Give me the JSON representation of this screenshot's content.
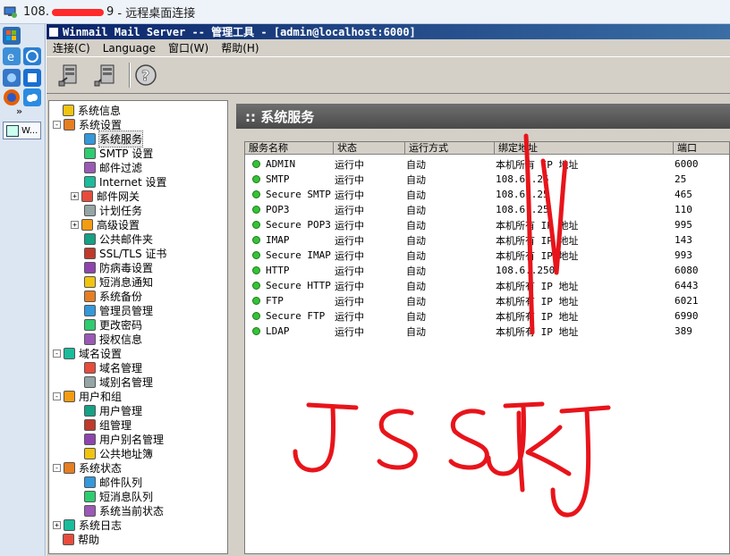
{
  "rdp": {
    "title_ip_prefix": "108.",
    "title_ip_suffix": "9",
    "title_text": "- 远程桌面连接"
  },
  "taskbar": {
    "more": "»",
    "task_label": "W..."
  },
  "app": {
    "title": "Winmail Mail Server -- 管理工具 - [admin@localhost:6000]",
    "menu": [
      "连接(C)",
      "Language",
      "窗口(W)",
      "帮助(H)"
    ]
  },
  "tree": [
    {
      "label": "系统信息",
      "icon": "info-icon",
      "level": 0,
      "exp": ""
    },
    {
      "label": "系统设置",
      "icon": "settings-folder-icon",
      "level": 0,
      "exp": "-"
    },
    {
      "label": "系统服务",
      "icon": "service-icon",
      "level": 1,
      "exp": "",
      "selected": true
    },
    {
      "label": "SMTP 设置",
      "icon": "smtp-icon",
      "level": 1,
      "exp": ""
    },
    {
      "label": "邮件过滤",
      "icon": "filter-icon",
      "level": 1,
      "exp": ""
    },
    {
      "label": "Internet 设置",
      "icon": "internet-icon",
      "level": 1,
      "exp": ""
    },
    {
      "label": "邮件网关",
      "icon": "gateway-icon",
      "level": 1,
      "exp": "+"
    },
    {
      "label": "计划任务",
      "icon": "schedule-icon",
      "level": 1,
      "exp": ""
    },
    {
      "label": "高级设置",
      "icon": "advanced-icon",
      "level": 1,
      "exp": "+"
    },
    {
      "label": "公共邮件夹",
      "icon": "public-folder-icon",
      "level": 1,
      "exp": ""
    },
    {
      "label": "SSL/TLS 证书",
      "icon": "certificate-icon",
      "level": 1,
      "exp": ""
    },
    {
      "label": "防病毒设置",
      "icon": "antivirus-icon",
      "level": 1,
      "exp": ""
    },
    {
      "label": "短消息通知",
      "icon": "sms-icon",
      "level": 1,
      "exp": ""
    },
    {
      "label": "系统备份",
      "icon": "backup-icon",
      "level": 1,
      "exp": ""
    },
    {
      "label": "管理员管理",
      "icon": "admin-icon",
      "level": 1,
      "exp": ""
    },
    {
      "label": "更改密码",
      "icon": "password-icon",
      "level": 1,
      "exp": ""
    },
    {
      "label": "授权信息",
      "icon": "license-icon",
      "level": 1,
      "exp": ""
    },
    {
      "label": "域名设置",
      "icon": "domain-settings-icon",
      "level": 0,
      "exp": "-"
    },
    {
      "label": "域名管理",
      "icon": "domain-icon",
      "level": 1,
      "exp": ""
    },
    {
      "label": "域别名管理",
      "icon": "domain-alias-icon",
      "level": 1,
      "exp": ""
    },
    {
      "label": "用户和组",
      "icon": "users-groups-icon",
      "level": 0,
      "exp": "-"
    },
    {
      "label": "用户管理",
      "icon": "user-icon",
      "level": 1,
      "exp": ""
    },
    {
      "label": "组管理",
      "icon": "group-icon",
      "level": 1,
      "exp": ""
    },
    {
      "label": "用户别名管理",
      "icon": "user-alias-icon",
      "level": 1,
      "exp": ""
    },
    {
      "label": "公共地址簿",
      "icon": "address-book-icon",
      "level": 1,
      "exp": ""
    },
    {
      "label": "系统状态",
      "icon": "status-icon",
      "level": 0,
      "exp": "-"
    },
    {
      "label": "邮件队列",
      "icon": "mail-queue-icon",
      "level": 1,
      "exp": ""
    },
    {
      "label": "短消息队列",
      "icon": "sms-queue-icon",
      "level": 1,
      "exp": ""
    },
    {
      "label": "系统当前状态",
      "icon": "current-status-icon",
      "level": 1,
      "exp": ""
    },
    {
      "label": "系统日志",
      "icon": "log-icon",
      "level": 0,
      "exp": "+"
    },
    {
      "label": "帮助",
      "icon": "help-icon",
      "level": 0,
      "exp": ""
    }
  ],
  "content": {
    "header": ":: 系统服务",
    "columns": [
      "服务名称",
      "状态",
      "运行方式",
      "绑定地址",
      "端口"
    ],
    "rows": [
      {
        "name": "ADMIN",
        "status": "运行中",
        "mode": "自动",
        "addr": "本机所有 IP 地址",
        "port": "6000"
      },
      {
        "name": "SMTP",
        "status": "运行中",
        "mode": "自动",
        "addr": "108.6..25",
        "port": "25"
      },
      {
        "name": "Secure SMTP",
        "status": "运行中",
        "mode": "自动",
        "addr": "108.6..25",
        "port": "465"
      },
      {
        "name": "POP3",
        "status": "运行中",
        "mode": "自动",
        "addr": "108.6..25",
        "port": "110"
      },
      {
        "name": "Secure POP3",
        "status": "运行中",
        "mode": "自动",
        "addr": "本机所有 IP 地址",
        "port": "995"
      },
      {
        "name": "IMAP",
        "status": "运行中",
        "mode": "自动",
        "addr": "本机所有 IP 地址",
        "port": "143"
      },
      {
        "name": "Secure IMAP",
        "status": "运行中",
        "mode": "自动",
        "addr": "本机所有 IP 地址",
        "port": "993"
      },
      {
        "name": "HTTP",
        "status": "运行中",
        "mode": "自动",
        "addr": "108.6..250",
        "port": "6080"
      },
      {
        "name": "Secure HTTP",
        "status": "运行中",
        "mode": "自动",
        "addr": "本机所有 IP 地址",
        "port": "6443"
      },
      {
        "name": "FTP",
        "status": "运行中",
        "mode": "自动",
        "addr": "本机所有 IP 地址",
        "port": "6021"
      },
      {
        "name": "Secure FTP",
        "status": "运行中",
        "mode": "自动",
        "addr": "本机所有 IP 地址",
        "port": "6990"
      },
      {
        "name": "LDAP",
        "status": "运行中",
        "mode": "自动",
        "addr": "本机所有 IP 地址",
        "port": "389"
      }
    ]
  },
  "annotation": {
    "handwriting": "JSSJKJ",
    "ink_color": "#e8141b"
  },
  "colors": {
    "running_dot": "#36c236",
    "title_bar": "#0a246a",
    "header_band": "#5a5a5a"
  }
}
